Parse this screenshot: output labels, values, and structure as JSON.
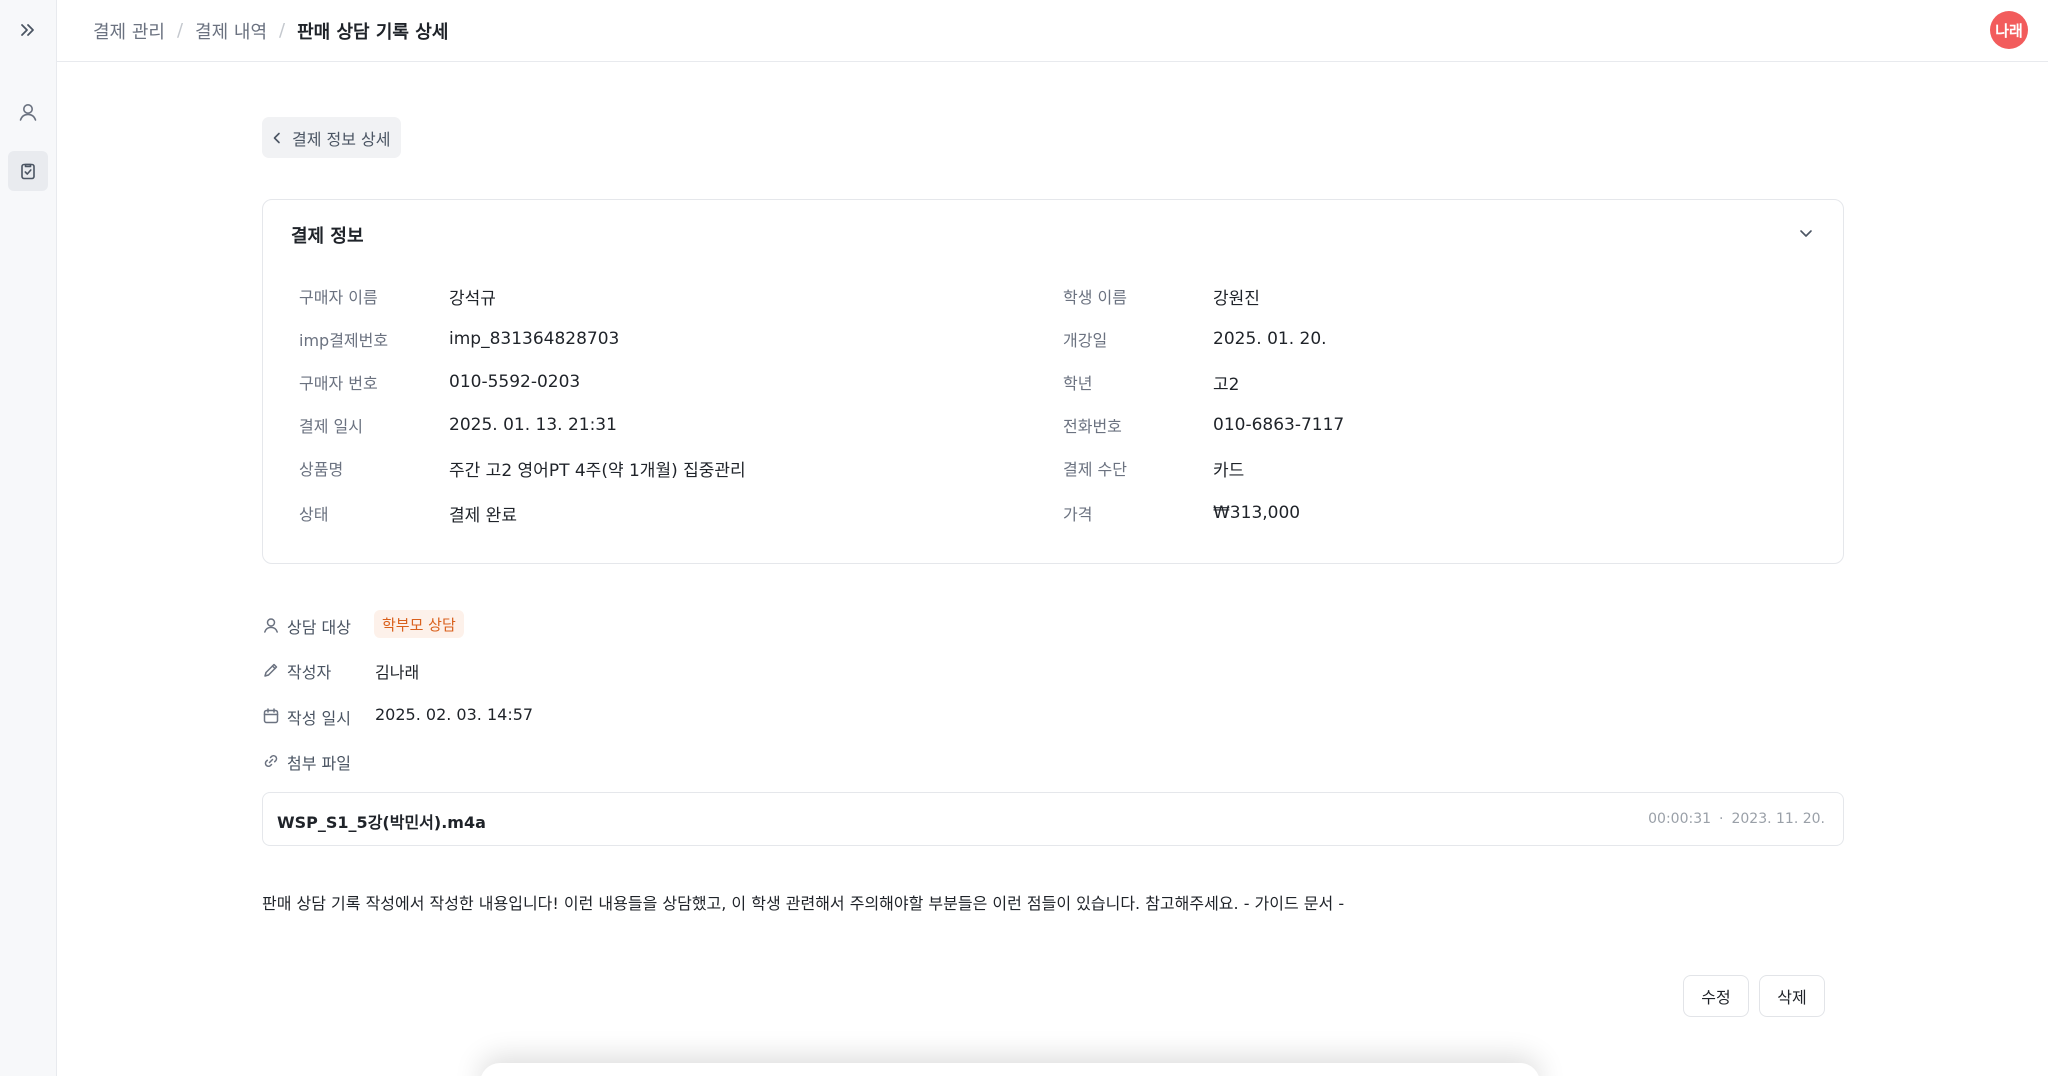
{
  "breadcrumb": [
    "결제 관리",
    "결제 내역",
    "판매 상담 기록 상세"
  ],
  "user": {
    "avatar_text": "나래",
    "avatar_color": "#f25c5c"
  },
  "back_button": {
    "label": "결제 정보 상세"
  },
  "payment_info": {
    "title": "결제 정보",
    "left": [
      {
        "label": "구매자 이름",
        "value": "강석규"
      },
      {
        "label": "imp결제번호",
        "value": "imp_831364828703"
      },
      {
        "label": "구매자 번호",
        "value": "010-5592-0203"
      },
      {
        "label": "결제 일시",
        "value": "2025. 01. 13. 21:31"
      },
      {
        "label": "상품명",
        "value": "주간 고2 영어PT 4주(약 1개월) 집중관리"
      },
      {
        "label": "상태",
        "value": "결제 완료"
      }
    ],
    "right": [
      {
        "label": "학생 이름",
        "value": "강원진"
      },
      {
        "label": "개강일",
        "value": "2025. 01. 20."
      },
      {
        "label": "학년",
        "value": "고2"
      },
      {
        "label": "전화번호",
        "value": "010-6863-7117"
      },
      {
        "label": "결제 수단",
        "value": "카드"
      },
      {
        "label": "가격",
        "value": "₩313,000"
      }
    ]
  },
  "consultation": {
    "target_label": "상담 대상",
    "target_value": "학부모 상담",
    "author_label": "작성자",
    "author_value": "김나래",
    "date_label": "작성 일시",
    "date_value": "2025. 02. 03. 14:57",
    "attachment_label": "첨부 파일"
  },
  "attachment": {
    "name": "WSP_S1_5강(박민서).m4a",
    "duration": "00:00:31",
    "separator": "·",
    "date": "2023. 11. 20."
  },
  "note": "판매 상담 기록 작성에서 작성한 내용입니다! 이런 내용들을 상담했고, 이 학생 관련해서 주의해야할 부분들은 이런 점들이 있습니다. 참고해주세요. - 가이드 문서 -",
  "actions": {
    "edit_label": "수정",
    "delete_label": "삭제"
  },
  "colors": {
    "accent_badge_bg": "#fdf1ea",
    "accent_badge_text": "#d9601c"
  }
}
